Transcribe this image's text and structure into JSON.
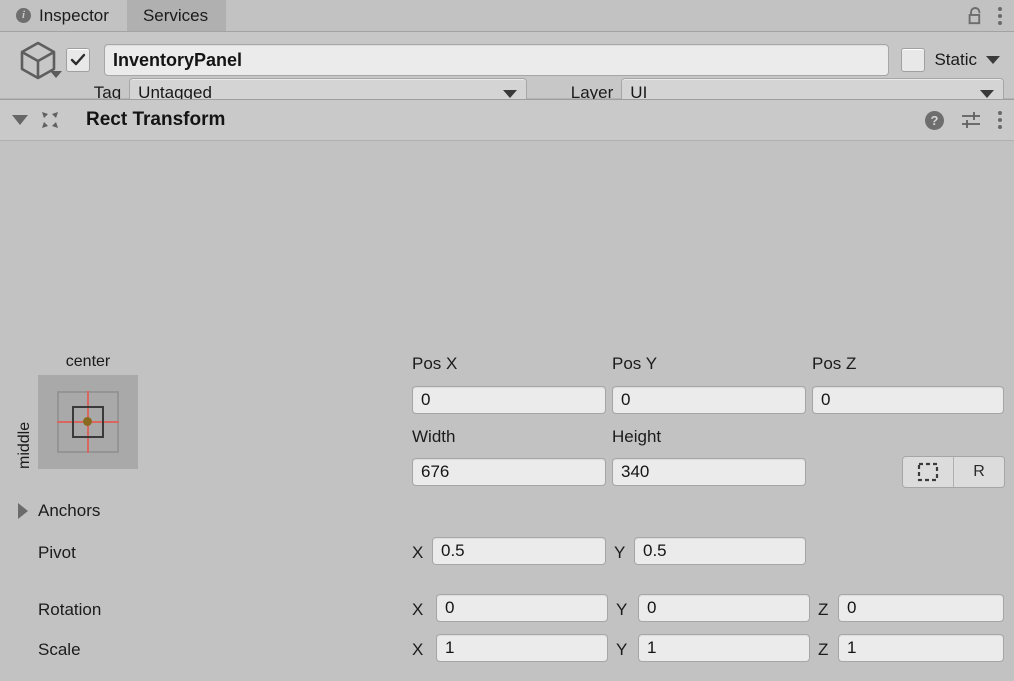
{
  "window": {
    "tabs": [
      {
        "label": "Inspector",
        "icon": "info-icon",
        "active": true
      },
      {
        "label": "Services",
        "icon": "",
        "active": false
      }
    ],
    "lock_icon": "unlock-icon",
    "menu_icon": "kebab-menu-icon"
  },
  "gameobject": {
    "icon": "cube-icon",
    "active_checkbox": true,
    "name": "InventoryPanel",
    "static_checkbox": false,
    "static_label": "Static",
    "tag_label": "Tag",
    "tag_value": "Untagged",
    "layer_label": "Layer",
    "layer_value": "UI"
  },
  "component": {
    "title": "Rect Transform",
    "icon": "rect-transform-icon",
    "expanded": true,
    "help_icon": "help-icon",
    "preset_icon": "preset-sliders-icon",
    "menu_icon": "kebab-menu-icon",
    "anchor_preset": {
      "horizontal": "center",
      "vertical": "middle"
    },
    "position": {
      "labels": [
        "Pos X",
        "Pos Y",
        "Pos Z"
      ],
      "values": [
        "0",
        "0",
        "0"
      ]
    },
    "size": {
      "labels": [
        "Width",
        "Height"
      ],
      "values": [
        "676",
        "340"
      ]
    },
    "buttons": {
      "blueprint": "blueprint-mode-icon",
      "raw": "R"
    },
    "anchors_label": "Anchors",
    "pivot": {
      "label": "Pivot",
      "axes": [
        "X",
        "Y"
      ],
      "values": [
        "0.5",
        "0.5"
      ]
    },
    "rotation": {
      "label": "Rotation",
      "axes": [
        "X",
        "Y",
        "Z"
      ],
      "values": [
        "0",
        "0",
        "0"
      ]
    },
    "scale": {
      "label": "Scale",
      "axes": [
        "X",
        "Y",
        "Z"
      ],
      "values": [
        "1",
        "1",
        "1"
      ]
    }
  }
}
